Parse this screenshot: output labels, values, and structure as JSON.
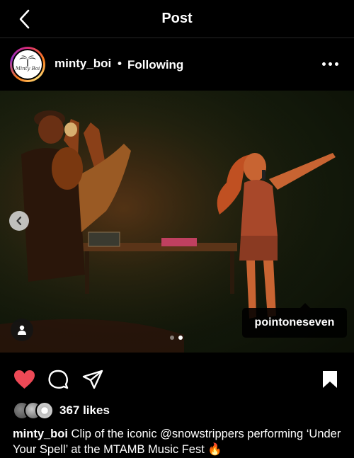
{
  "topbar": {
    "title": "Post",
    "back_icon": "chevron-left-icon"
  },
  "post": {
    "username": "minty_boi",
    "separator": "•",
    "follow_status": "Following",
    "avatar_text": "Minty Boi",
    "menu_icon": "more-horizontal-icon"
  },
  "media": {
    "tagged_user": "pointoneseven",
    "carousel": {
      "total": 2,
      "current": 2
    }
  },
  "actions": {
    "liked": true,
    "like_color": "#ed4956",
    "icons": [
      "heart-icon",
      "comment-icon",
      "share-icon",
      "bookmark-icon"
    ]
  },
  "likes": {
    "label": "367 likes"
  },
  "caption": {
    "username": "minty_boi",
    "text": "Clip of the iconic @snowstrippers performing ‘Under Your Spell’ at the MTAMB Music Fest 🔥"
  }
}
